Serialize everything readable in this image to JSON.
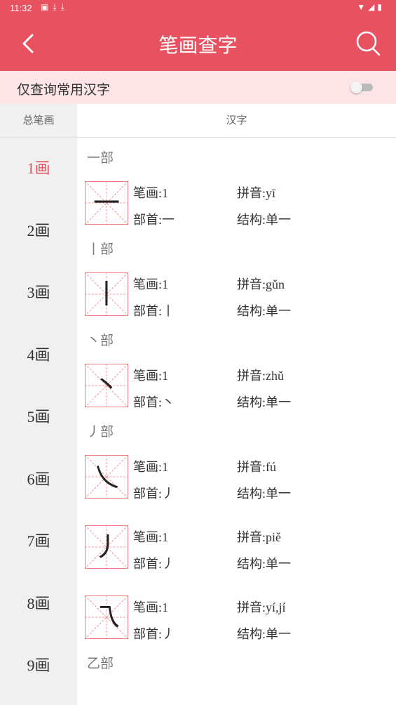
{
  "status": {
    "time": "11:32"
  },
  "appbar": {
    "title": "笔画查字"
  },
  "filter": {
    "label": "仅查询常用汉字",
    "enabled": false
  },
  "headers": {
    "strokes": "总笔画",
    "chars": "汉字"
  },
  "strokes": [
    "1画",
    "2画",
    "3画",
    "4画",
    "5画",
    "6画",
    "7画",
    "8画",
    "9画"
  ],
  "active_stroke": "1画",
  "groups": [
    {
      "radical": "一部",
      "entries": [
        {
          "glyph": "一",
          "strokes": "笔画:1",
          "pinyin": "拼音:yī",
          "radical": "部首:一",
          "structure": "结构:单一"
        }
      ]
    },
    {
      "radical": "丨部",
      "entries": [
        {
          "glyph": "丨",
          "strokes": "笔画:1",
          "pinyin": "拼音:gǔn",
          "radical": "部首:丨",
          "structure": "结构:单一"
        }
      ]
    },
    {
      "radical": "丶部",
      "entries": [
        {
          "glyph": "丶",
          "strokes": "笔画:1",
          "pinyin": "拼音:zhǔ",
          "radical": "部首:丶",
          "structure": "结构:单一"
        }
      ]
    },
    {
      "radical": "丿部",
      "entries": [
        {
          "glyph": "乀",
          "strokes": "笔画:1",
          "pinyin": "拼音:fú",
          "radical": "部首:丿",
          "structure": "结构:单一"
        },
        {
          "glyph": "丿",
          "strokes": "笔画:1",
          "pinyin": "拼音:piě",
          "radical": "部首:丿",
          "structure": "结构:单一"
        },
        {
          "glyph": "乁",
          "strokes": "笔画:1",
          "pinyin": "拼音:yí,jí",
          "radical": "部首:丿",
          "structure": "结构:单一"
        }
      ]
    },
    {
      "radical": "乙部",
      "entries": []
    }
  ],
  "colors": {
    "primary": "#e8515f",
    "filter_bg": "#fde4e6",
    "sidebar_bg": "#f0f0f0",
    "grid": "#f08080"
  },
  "icons": {
    "back": "chevron-left-icon",
    "search": "search-icon"
  }
}
